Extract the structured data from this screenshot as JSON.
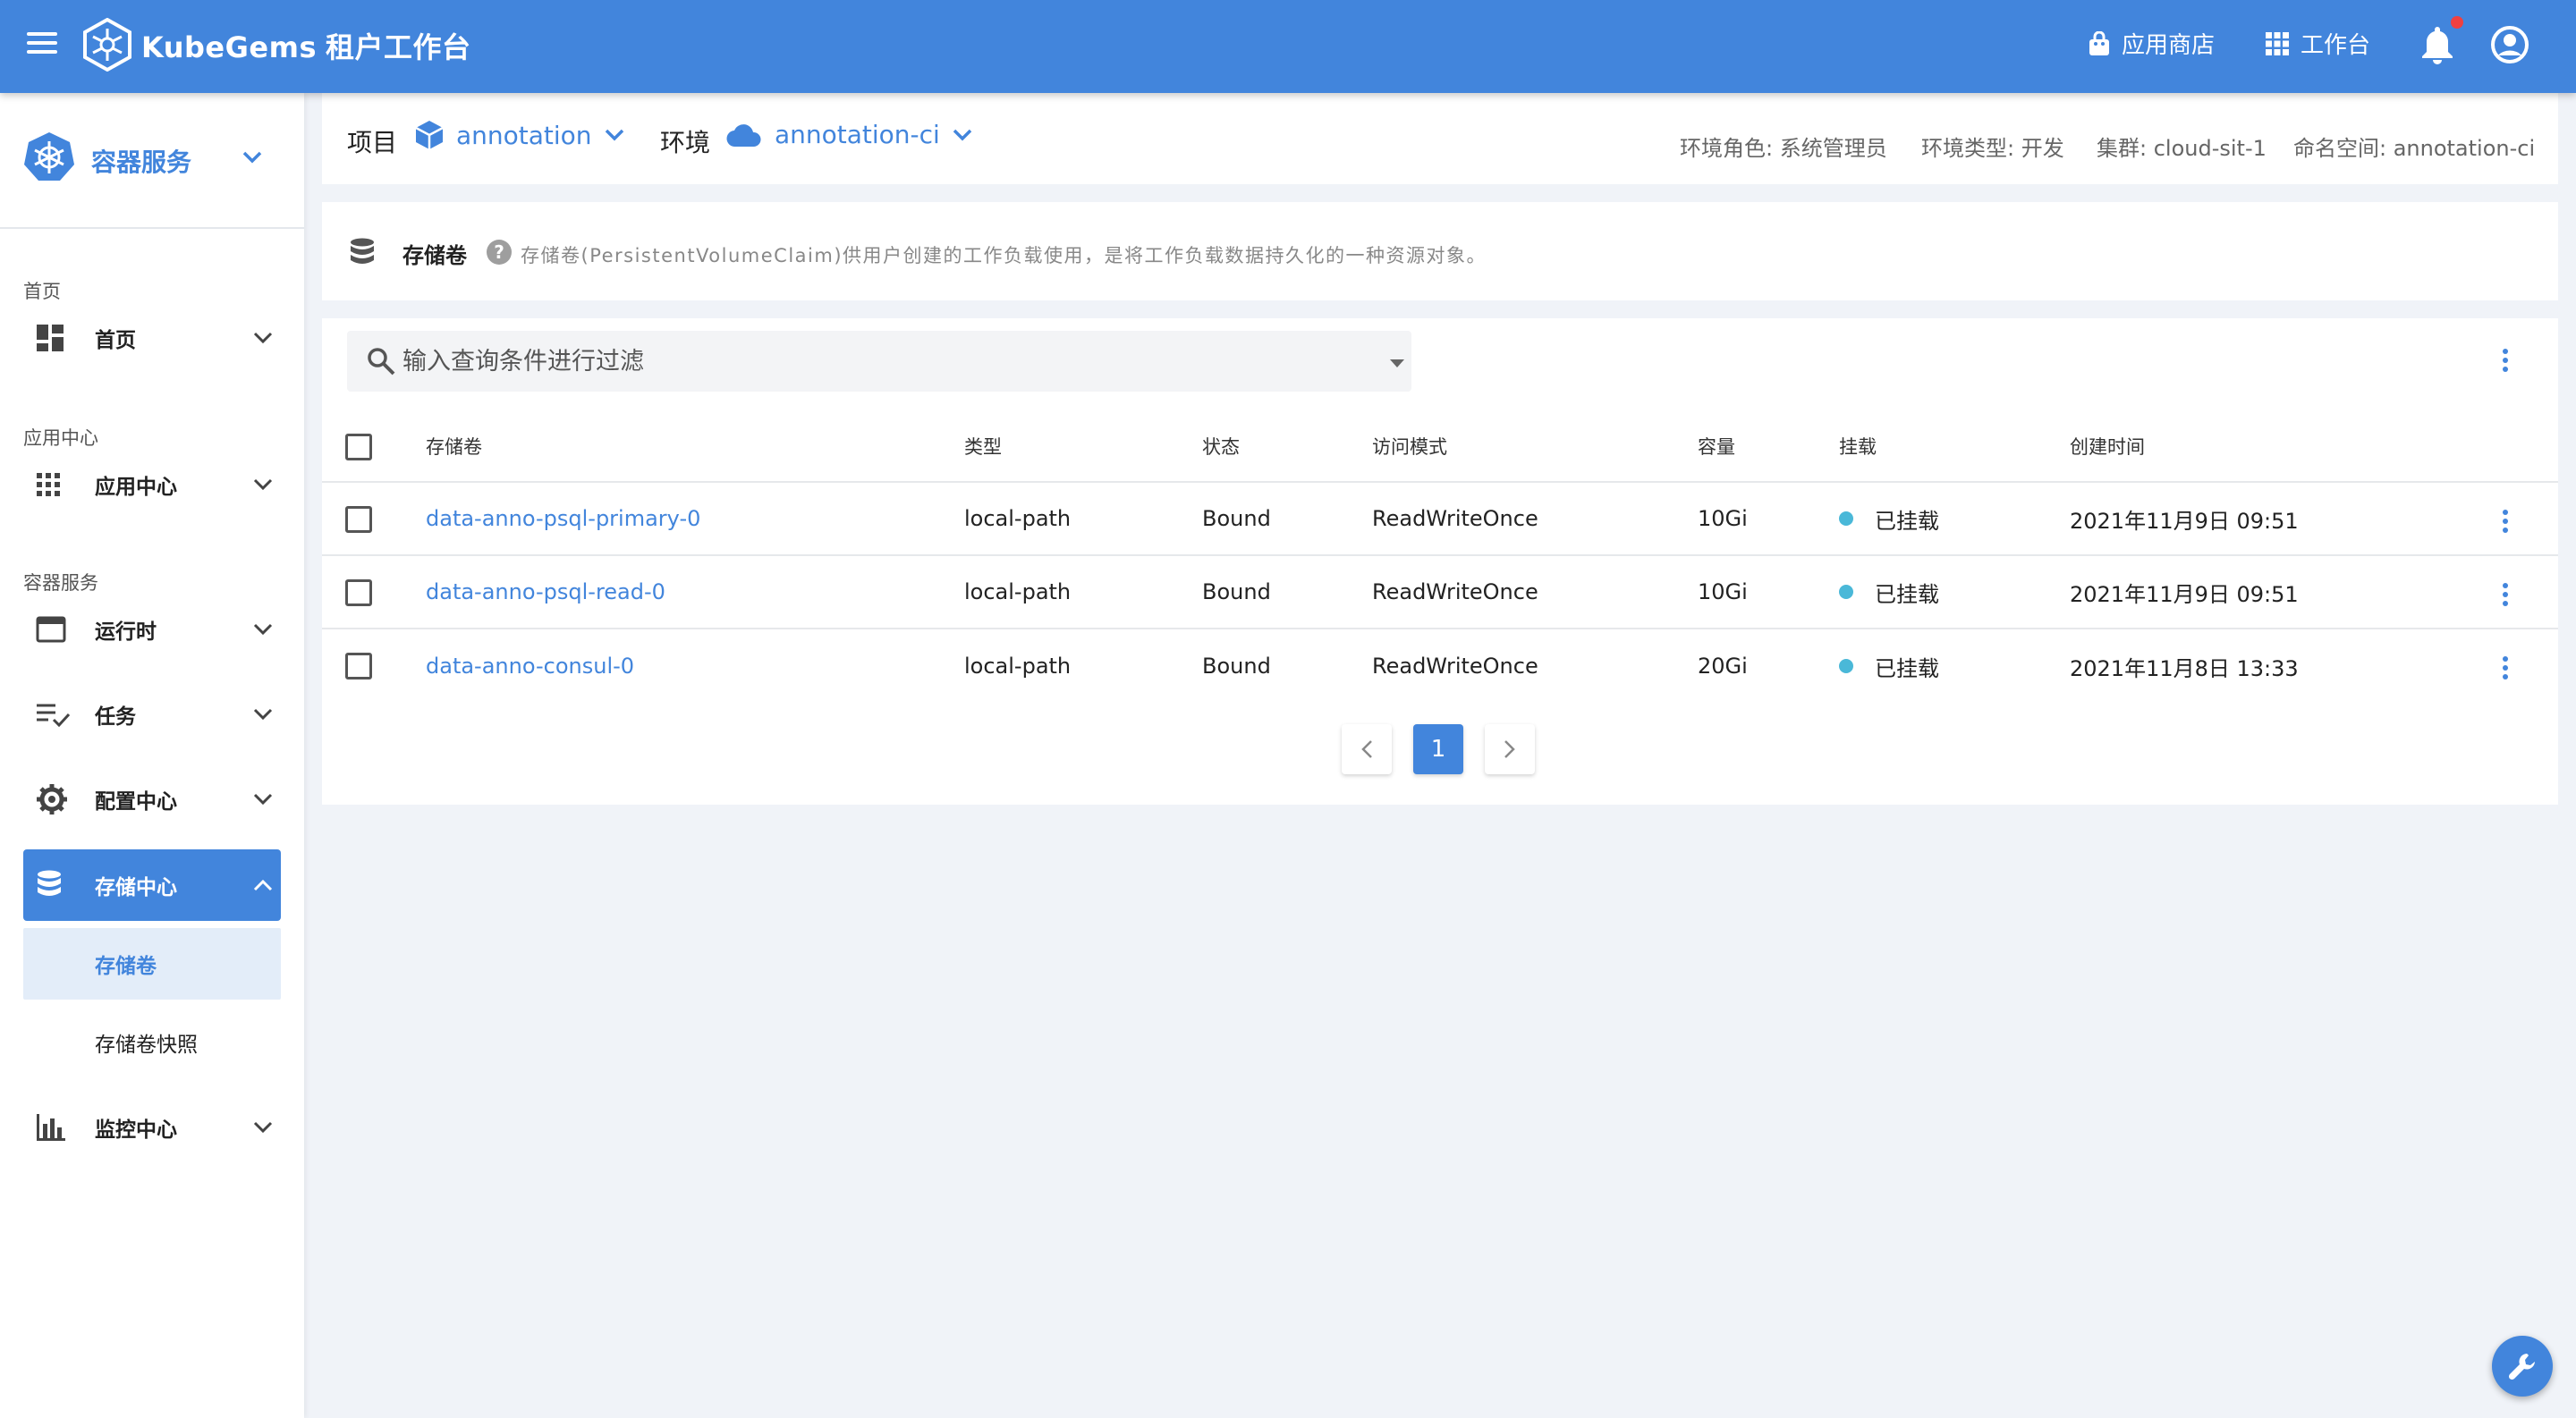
{
  "app": {
    "brand": "KubeGems",
    "subtitle": "租户工作台"
  },
  "topbar": {
    "app_store": "应用商店",
    "workspace": "工作台"
  },
  "sidebar": {
    "service_title": "容器服务",
    "groups": [
      {
        "label": "首页",
        "items": [
          {
            "label": "首页",
            "icon": "dashboard-icon"
          }
        ]
      },
      {
        "label": "应用中心",
        "items": [
          {
            "label": "应用中心",
            "icon": "apps-grid-icon"
          }
        ]
      },
      {
        "label": "容器服务",
        "items": [
          {
            "label": "运行时",
            "icon": "window-icon"
          },
          {
            "label": "任务",
            "icon": "playlist-check-icon"
          },
          {
            "label": "配置中心",
            "icon": "gear-icon"
          },
          {
            "label": "存储中心",
            "icon": "database-icon",
            "expanded": true,
            "children": [
              {
                "label": "存储卷",
                "active": true
              },
              {
                "label": "存储卷快照"
              }
            ]
          },
          {
            "label": "监控中心",
            "icon": "bar-chart-icon"
          }
        ]
      }
    ]
  },
  "context": {
    "project_label": "项目",
    "project_value": "annotation",
    "env_label": "环境",
    "env_value": "annotation-ci",
    "env_role": "环境角色: 系统管理员",
    "env_type": "环境类型: 开发",
    "cluster": "集群: cloud-sit-1",
    "namespace": "命名空间: annotation-ci"
  },
  "page": {
    "title": "存储卷",
    "help": "?",
    "description": "存储卷(PersistentVolumeClaim)供用户创建的工作负载使用，是将工作负载数据持久化的一种资源对象。"
  },
  "search": {
    "placeholder": "输入查询条件进行过滤"
  },
  "table": {
    "columns": [
      "存储卷",
      "类型",
      "状态",
      "访问模式",
      "容量",
      "挂载",
      "创建时间"
    ],
    "rows": [
      {
        "name": "data-anno-psql-primary-0",
        "type": "local-path",
        "status": "Bound",
        "access_mode": "ReadWriteOnce",
        "capacity": "10Gi",
        "mount": "已挂载",
        "created": "2021年11月9日 09:51"
      },
      {
        "name": "data-anno-psql-read-0",
        "type": "local-path",
        "status": "Bound",
        "access_mode": "ReadWriteOnce",
        "capacity": "10Gi",
        "mount": "已挂载",
        "created": "2021年11月9日 09:51"
      },
      {
        "name": "data-anno-consul-0",
        "type": "local-path",
        "status": "Bound",
        "access_mode": "ReadWriteOnce",
        "capacity": "20Gi",
        "mount": "已挂载",
        "created": "2021年11月8日 13:33"
      }
    ]
  },
  "pagination": {
    "current_page": "1"
  },
  "colors": {
    "primary": "#4285dc",
    "mounted_dot": "#4ab8d8",
    "notification_dot": "#f04040",
    "background": "#f0f3f8"
  }
}
